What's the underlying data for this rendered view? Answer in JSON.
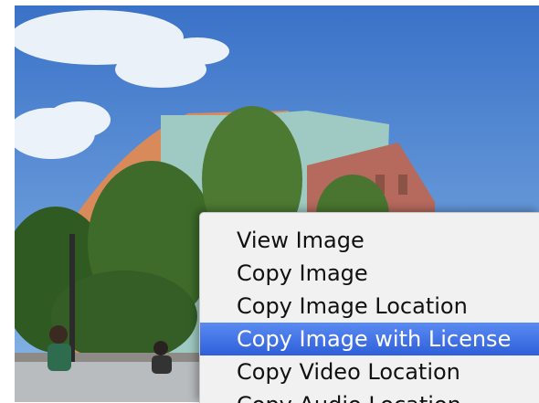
{
  "context_menu": {
    "items": [
      {
        "label": "View Image",
        "highlighted": false
      },
      {
        "label": "Copy Image",
        "highlighted": false
      },
      {
        "label": "Copy Image Location",
        "highlighted": false
      },
      {
        "label": "Copy Image with License",
        "highlighted": true
      },
      {
        "label": "Copy Video Location",
        "highlighted": false
      },
      {
        "label": "Copy Audio Location",
        "highlighted": false
      }
    ],
    "highlight_color": "#3b6fe0"
  },
  "colors": {
    "sky_top": "#3a72c8",
    "sky_bottom": "#8ab7e6"
  }
}
